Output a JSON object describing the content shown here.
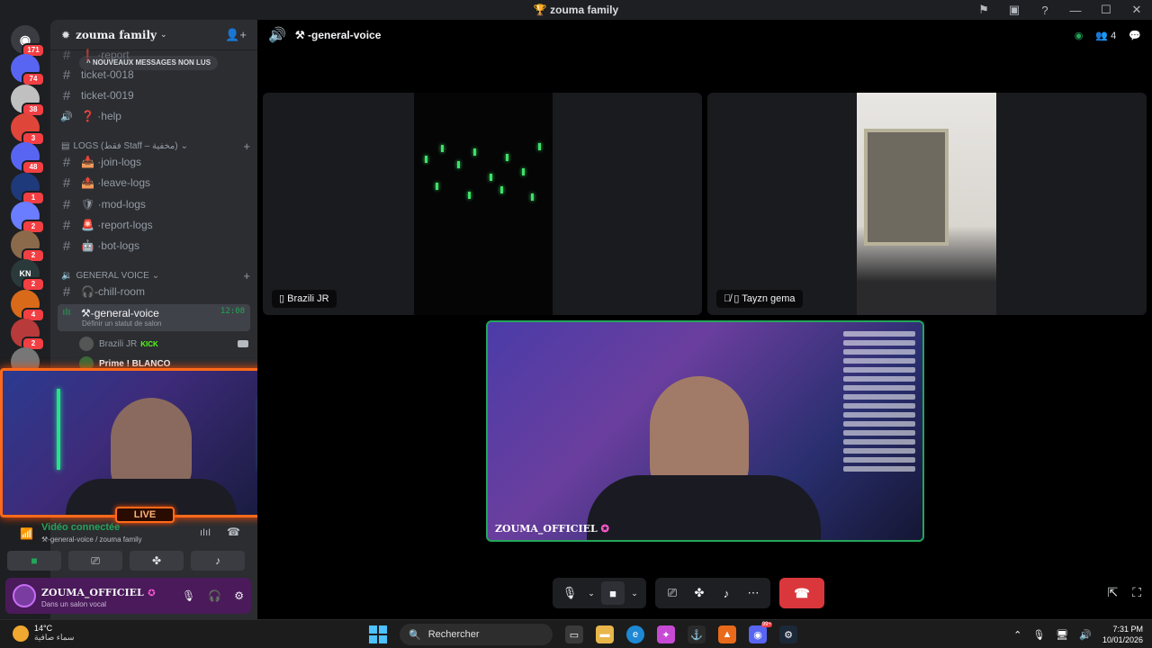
{
  "window": {
    "title": "zouma family",
    "title_icon": "trophy-icon"
  },
  "servers": [
    {
      "badge": "171",
      "color": "#3a3c42",
      "label": "DM"
    },
    {
      "badge": "74",
      "color": "#5865f2",
      "label": ""
    },
    {
      "badge": "38",
      "color": "#c0c0c0",
      "label": ""
    },
    {
      "badge": "3",
      "color": "#e0453a",
      "label": ""
    },
    {
      "badge": "48",
      "color": "#5865f2",
      "label": ""
    },
    {
      "badge": "1",
      "color": "#1f3a7a",
      "label": ""
    },
    {
      "badge": "2",
      "color": "#6a7cff",
      "label": ""
    },
    {
      "badge": "2",
      "color": "#8a6a4a",
      "label": ""
    },
    {
      "badge": "2",
      "color": "#2a3a3a",
      "label": "KN"
    },
    {
      "badge": "4",
      "color": "#d86a1a",
      "label": ""
    },
    {
      "badge": "2",
      "color": "#b83a3a",
      "label": ""
    },
    {
      "badge": "",
      "color": "#777777",
      "label": ""
    }
  ],
  "sidebar": {
    "guild_name": "zouma family",
    "new_messages": "NOUVEAUX MESSAGES NON LUS",
    "top_channels": [
      {
        "name": "report",
        "prefix": "#",
        "emoji": "❗"
      },
      {
        "name": "ticket-0018",
        "prefix": "#",
        "emoji": ""
      },
      {
        "name": "ticket-0019",
        "prefix": "#",
        "emoji": ""
      },
      {
        "name": "help",
        "prefix": "🔊",
        "emoji": "❓"
      }
    ],
    "logs_category": "LOGS (فقط Staff – مخفية)",
    "logs_channels": [
      {
        "name": "join-logs",
        "emoji": "📥"
      },
      {
        "name": "leave-logs",
        "emoji": "📤"
      },
      {
        "name": "mod-logs",
        "emoji": "🛡"
      },
      {
        "name": "report-logs",
        "emoji": "🚨"
      },
      {
        "name": "bot-logs",
        "emoji": "🤖"
      }
    ],
    "voice_category": "GENERAL VOICE",
    "chill_room": "-chill-room",
    "general_voice": {
      "name": "-general-voice",
      "time": "12:08",
      "status": "Définir un statut de salon"
    },
    "voice_users": [
      {
        "name": "Brazili JR",
        "tag": "KICK"
      },
      {
        "name": "Prime ! BLANCO",
        "tag": ""
      }
    ]
  },
  "overlay": {
    "live_label": "LIVE"
  },
  "voice_panel": {
    "status": "Vidéo connectée",
    "channel": "-general-voice / zouma family"
  },
  "user": {
    "name": "ZOUMA_OFFICIEL",
    "status": "Dans un salon vocal"
  },
  "main": {
    "channel_title": "-general-voice",
    "member_count": "4",
    "tiles": [
      {
        "name": "Brazili JR"
      },
      {
        "name": "Tayzn gema"
      }
    ],
    "focused": {
      "name": "ZOUMA_OFFICIEL"
    }
  },
  "taskbar": {
    "temperature": "14°C",
    "weather_text": "سماء صافية",
    "search_placeholder": "Rechercher",
    "time": "7:31 PM",
    "date": "10/01/2026",
    "discord_badge": "99+"
  }
}
